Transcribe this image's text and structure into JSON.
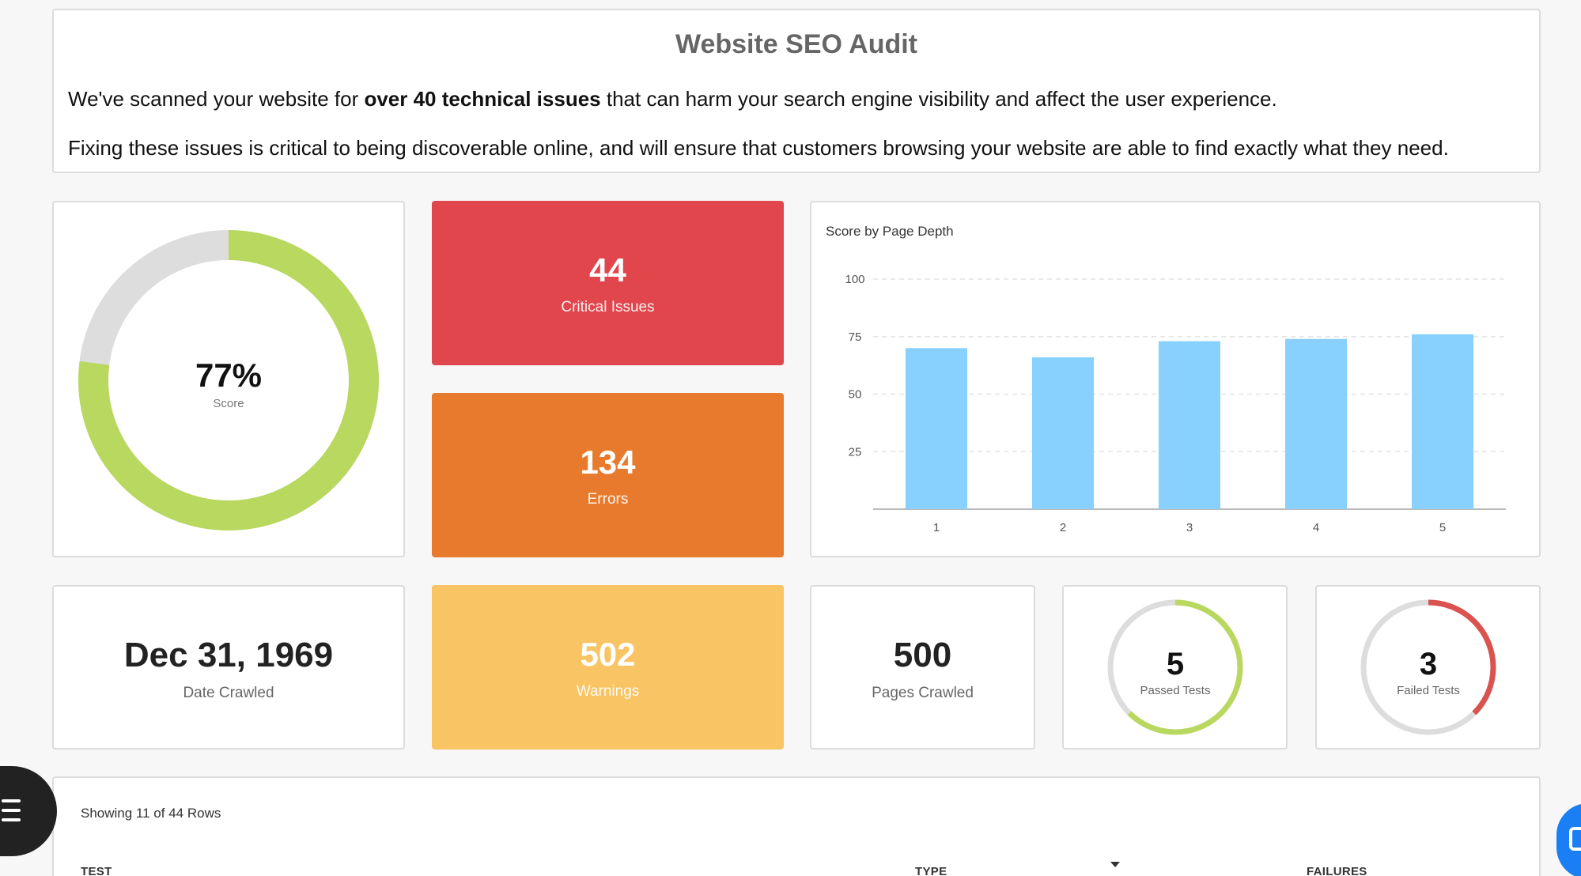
{
  "intro": {
    "title": "Website SEO Audit",
    "line1_pre": "We've scanned your website for ",
    "line1_bold": "over 40 technical issues",
    "line1_post": " that can harm your search engine visibility and affect the user experience.",
    "line2": "Fixing these issues is critical to being discoverable online, and will ensure that customers browsing your website are able to find exactly what they need."
  },
  "score": {
    "value": 77,
    "display": "77%",
    "label": "Score",
    "color": "#b9d85f",
    "track_color": "#dddddd"
  },
  "tiles": {
    "critical": {
      "value": "44",
      "label": "Critical Issues",
      "color": "#e0464c"
    },
    "errors": {
      "value": "134",
      "label": "Errors",
      "color": "#e87a2e"
    },
    "warnings": {
      "value": "502",
      "label": "Warnings",
      "color": "#f8c464"
    }
  },
  "stats": {
    "date": {
      "value": "Dec 31, 1969",
      "label": "Date Crawled"
    },
    "pages": {
      "value": "500",
      "label": "Pages Crawled"
    },
    "passed": {
      "value": "5",
      "label": "Passed Tests",
      "fraction": 0.625,
      "color": "#b9d85f"
    },
    "failed": {
      "value": "3",
      "label": "Failed Tests",
      "fraction": 0.375,
      "color": "#d9534f"
    }
  },
  "chart_data": {
    "type": "bar",
    "title": "Score by Page Depth",
    "categories": [
      "1",
      "2",
      "3",
      "4",
      "5"
    ],
    "values": [
      70,
      66,
      73,
      74,
      76
    ],
    "ylim": [
      0,
      100
    ],
    "yticks": [
      "25",
      "50",
      "75",
      "100"
    ],
    "grid": true,
    "bar_color": "#88d0fd"
  },
  "table": {
    "rows_info": "Showing 11 of 44 Rows",
    "headers": {
      "test": "TEST",
      "type": "TYPE",
      "failures": "FAILURES"
    }
  },
  "icons": {
    "menu": "menu-icon",
    "chat": "chat-icon"
  }
}
